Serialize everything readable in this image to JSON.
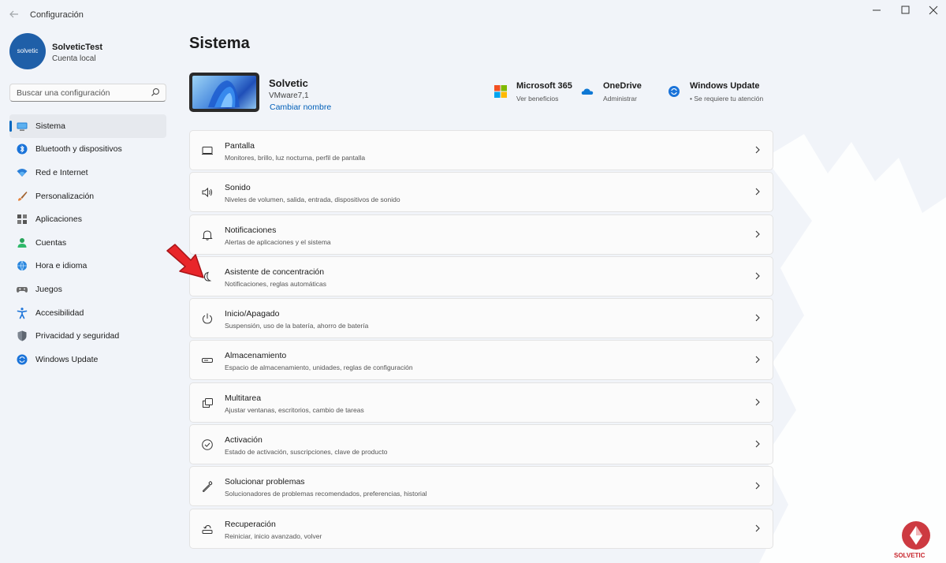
{
  "window": {
    "title": "Configuración",
    "controls": {
      "minimize": "—",
      "maximize": "☐",
      "close": "✕"
    }
  },
  "profile": {
    "avatar_text": "solvetic",
    "name": "SolveticTest",
    "account_type": "Cuenta local"
  },
  "search": {
    "placeholder": "Buscar una configuración"
  },
  "sidebar": {
    "items": [
      {
        "label": "Sistema",
        "icon": "monitor-icon",
        "active": true
      },
      {
        "label": "Bluetooth y dispositivos",
        "icon": "bluetooth-icon"
      },
      {
        "label": "Red e Internet",
        "icon": "wifi-icon"
      },
      {
        "label": "Personalización",
        "icon": "brush-icon"
      },
      {
        "label": "Aplicaciones",
        "icon": "apps-icon"
      },
      {
        "label": "Cuentas",
        "icon": "person-icon"
      },
      {
        "label": "Hora e idioma",
        "icon": "globe-clock-icon"
      },
      {
        "label": "Juegos",
        "icon": "gamepad-icon"
      },
      {
        "label": "Accesibilidad",
        "icon": "accessibility-icon"
      },
      {
        "label": "Privacidad y seguridad",
        "icon": "shield-icon"
      },
      {
        "label": "Windows Update",
        "icon": "sync-icon"
      }
    ]
  },
  "main": {
    "title": "Sistema",
    "device": {
      "name": "Solvetic",
      "model": "VMware7,1",
      "rename_link": "Cambiar nombre"
    },
    "quick_links": [
      {
        "title": "Microsoft 365",
        "subtitle": "Ver beneficios",
        "icon": "microsoft-logo-icon"
      },
      {
        "title": "OneDrive",
        "subtitle": "Administrar",
        "icon": "cloud-icon"
      },
      {
        "title": "Windows Update",
        "subtitle": "• Se requiere tu atención",
        "icon": "update-icon"
      }
    ],
    "cards": [
      {
        "title": "Pantalla",
        "subtitle": "Monitores, brillo, luz nocturna, perfil de pantalla",
        "icon": "display-icon"
      },
      {
        "title": "Sonido",
        "subtitle": "Niveles de volumen, salida, entrada, dispositivos de sonido",
        "icon": "speaker-icon"
      },
      {
        "title": "Notificaciones",
        "subtitle": "Alertas de aplicaciones y el sistema",
        "icon": "bell-icon"
      },
      {
        "title": "Asistente de concentración",
        "subtitle": "Notificaciones, reglas automáticas",
        "icon": "moon-icon"
      },
      {
        "title": "Inicio/Apagado",
        "subtitle": "Suspensión, uso de la batería, ahorro de batería",
        "icon": "power-icon"
      },
      {
        "title": "Almacenamiento",
        "subtitle": "Espacio de almacenamiento, unidades, reglas de configuración",
        "icon": "storage-icon"
      },
      {
        "title": "Multitarea",
        "subtitle": "Ajustar ventanas, escritorios, cambio de tareas",
        "icon": "multitask-icon"
      },
      {
        "title": "Activación",
        "subtitle": "Estado de activación, suscripciones, clave de producto",
        "icon": "checkmark-circle-icon"
      },
      {
        "title": "Solucionar problemas",
        "subtitle": "Solucionadores de problemas recomendados, preferencias, historial",
        "icon": "wrench-icon"
      },
      {
        "title": "Recuperación",
        "subtitle": "Reiniciar, inicio avanzado, volver",
        "icon": "recovery-icon"
      }
    ]
  },
  "watermark": {
    "text": "SOLVETIC"
  },
  "colors": {
    "accent": "#0067c0",
    "link": "#005fb8",
    "arrow": "#e8262a",
    "background": "#f1f4f9",
    "card": "#fbfbfb"
  }
}
